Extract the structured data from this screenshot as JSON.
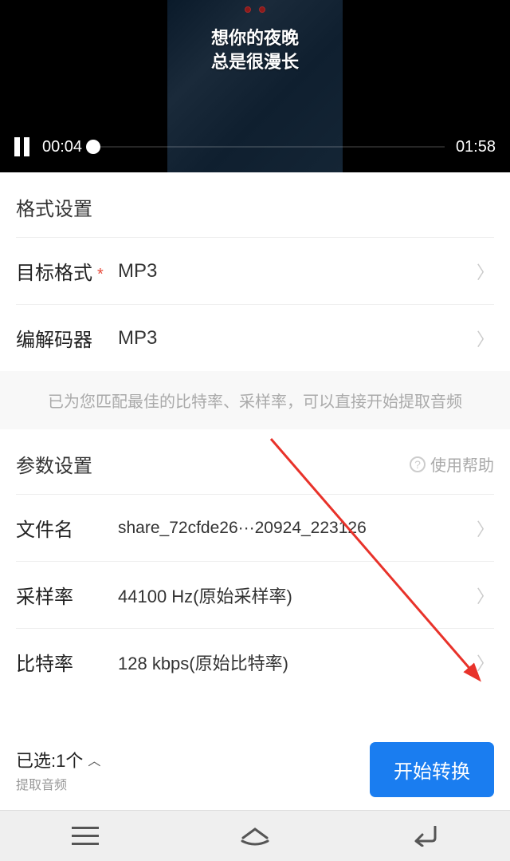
{
  "video": {
    "lyrics_line1": "想你的夜晚",
    "lyrics_line2": "总是很漫长",
    "current_time": "00:04",
    "total_time": "01:58"
  },
  "format_section": {
    "title": "格式设置",
    "target_format": {
      "label": "目标格式",
      "value": "MP3"
    },
    "codec": {
      "label": "编解码器",
      "value": "MP3"
    },
    "hint": "已为您匹配最佳的比特率、采样率，可以直接开始提取音频"
  },
  "param_section": {
    "title": "参数设置",
    "help_label": "使用帮助",
    "filename": {
      "label": "文件名",
      "value": "share_72cfde26···20924_223126"
    },
    "sample_rate": {
      "label": "采样率",
      "value": "44100 Hz(原始采样率)"
    },
    "bitrate": {
      "label": "比特率",
      "value": "128 kbps(原始比特率)"
    }
  },
  "bottom": {
    "selected_label": "已选:1个",
    "selected_sub": "提取音频",
    "start_button": "开始转换"
  }
}
